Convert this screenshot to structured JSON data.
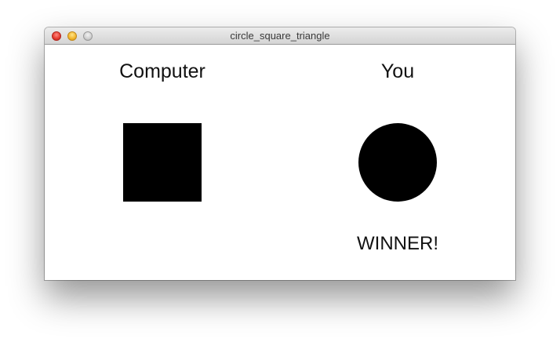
{
  "window": {
    "title": "circle_square_triangle",
    "buttons": {
      "close": "close-icon",
      "minimize": "minimize-icon",
      "zoom": "zoom-icon"
    }
  },
  "game": {
    "computer_label": "Computer",
    "player_label": "You",
    "computer_shape": "square",
    "player_shape": "circle",
    "result_text": "WINNER!"
  },
  "colors": {
    "shape": "#000000",
    "background": "#ffffff"
  }
}
